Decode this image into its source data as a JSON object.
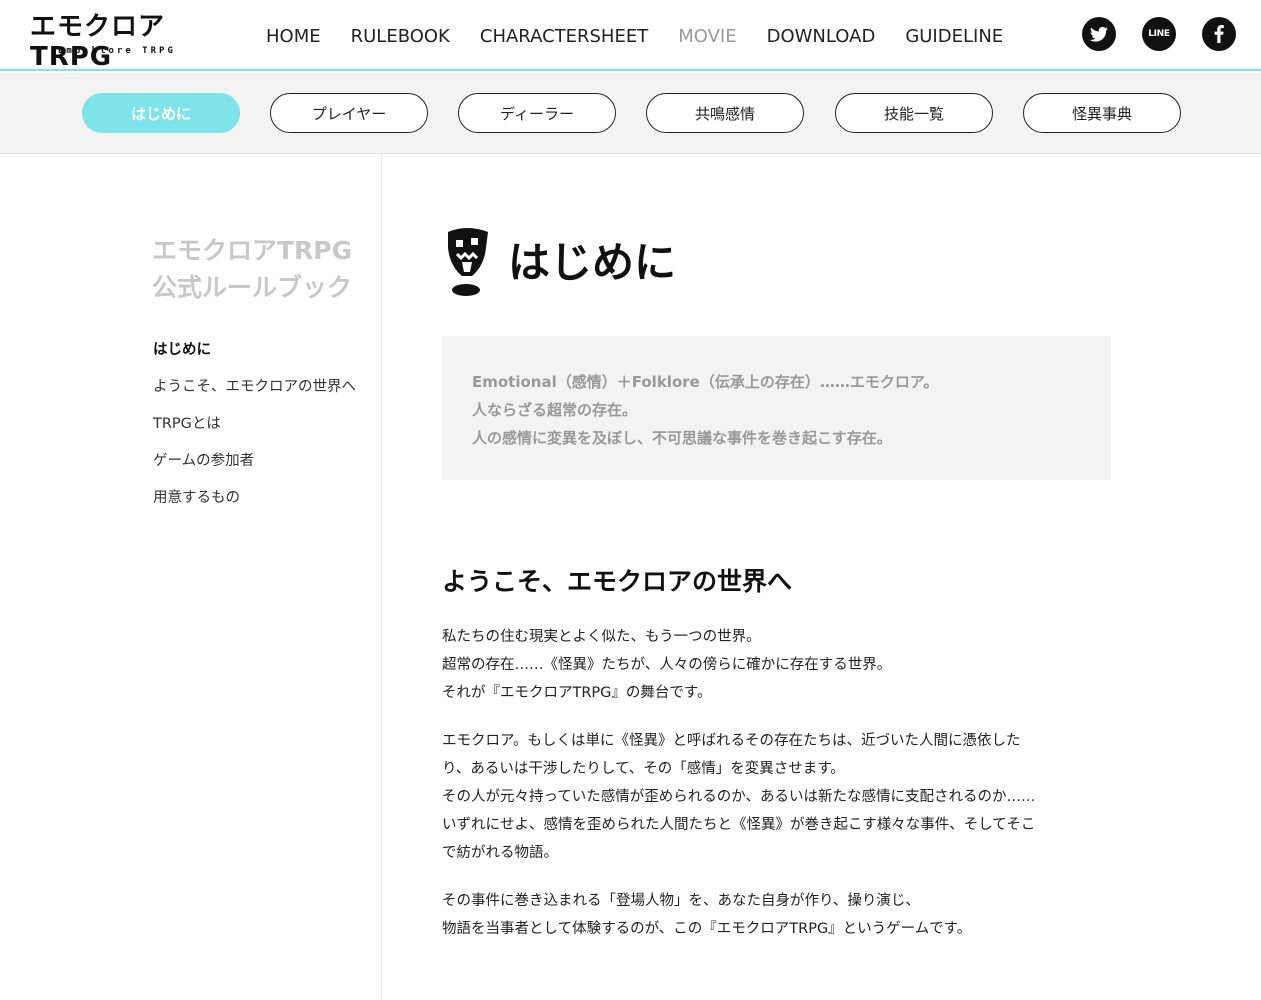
{
  "header": {
    "logo_main": "エモクロアTRPG",
    "logo_sub": "Emo-klore TRPG",
    "nav": [
      {
        "label": "HOME",
        "active": false
      },
      {
        "label": "RULEBOOK",
        "active": false
      },
      {
        "label": "CHARACTERSHEET",
        "active": false
      },
      {
        "label": "MOVIE",
        "active": true
      },
      {
        "label": "DOWNLOAD",
        "active": false
      },
      {
        "label": "GUIDELINE",
        "active": false
      }
    ],
    "social": {
      "line_label": "LINE"
    }
  },
  "subnav": {
    "tabs": [
      {
        "label": "はじめに",
        "active": true
      },
      {
        "label": "プレイヤー",
        "active": false
      },
      {
        "label": "ディーラー",
        "active": false
      },
      {
        "label": "共鳴感情",
        "active": false
      },
      {
        "label": "技能一覧",
        "active": false
      },
      {
        "label": "怪異事典",
        "active": false
      }
    ]
  },
  "sidebar": {
    "title_line1": "エモクロアTRPG",
    "title_line2": "公式ルールブック",
    "links": [
      {
        "label": "はじめに",
        "current": true
      },
      {
        "label": "ようこそ、エモクロアの世界へ",
        "current": false
      },
      {
        "label": "TRPGとは",
        "current": false
      },
      {
        "label": "ゲームの参加者",
        "current": false
      },
      {
        "label": "用意するもの",
        "current": false
      }
    ]
  },
  "main": {
    "heading": "はじめに",
    "intro": [
      "Emotional（感情）＋Folklore（伝承上の存在）……エモクロア。",
      "人ならざる超常の存在。",
      "人の感情に変異を及ぼし、不可思議な事件を巻き起こす存在。"
    ],
    "section_title": "ようこそ、エモクロアの世界へ",
    "paragraphs": [
      [
        "私たちの住む現実とよく似た、もう一つの世界。",
        "超常の存在……《怪異》たちが、人々の傍らに確かに存在する世界。",
        "それが『エモクロアTRPG』の舞台です。"
      ],
      [
        "エモクロア。もしくは単に《怪異》と呼ばれるその存在たちは、近づいた人間に憑依した",
        "り、あるいは干渉したりして、その「感情」を変異させます。",
        "その人が元々持っていた感情が歪められるのか、あるいは新たな感情に支配されるのか……",
        "いずれにせよ、感情を歪められた人間たちと《怪異》が巻き起こす様々な事件、そしてそこ",
        "で紡がれる物語。"
      ],
      [
        "その事件に巻き込まれる「登場人物」を、あなた自身が作り、操り演じ、",
        "物語を当事者として体験するのが、この『エモクロアTRPG』というゲームです。"
      ]
    ]
  },
  "colors": {
    "accent": "#7fe3ea",
    "muted_title": "#c8c8c8",
    "intro_text": "#999999",
    "nav_active": "#9a9a9a"
  },
  "icons": [
    "twitter-icon",
    "line-icon",
    "facebook-icon",
    "kaii-mascot-icon"
  ]
}
